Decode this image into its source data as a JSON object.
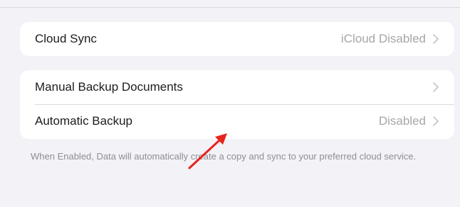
{
  "settings": {
    "cloud_sync": {
      "label": "Cloud Sync",
      "value": "iCloud Disabled",
      "icon": "chevron-right-icon"
    },
    "manual_backup": {
      "label": "Manual Backup Documents",
      "icon": "chevron-right-icon"
    },
    "automatic_backup": {
      "label": "Automatic Backup",
      "value": "Disabled",
      "icon": "chevron-right-icon"
    },
    "footer_note": "When Enabled, Data will automatically create a copy and sync to your preferred cloud service."
  },
  "annotation": {
    "icon": "red-arrow-icon",
    "color": "#e8231c"
  }
}
